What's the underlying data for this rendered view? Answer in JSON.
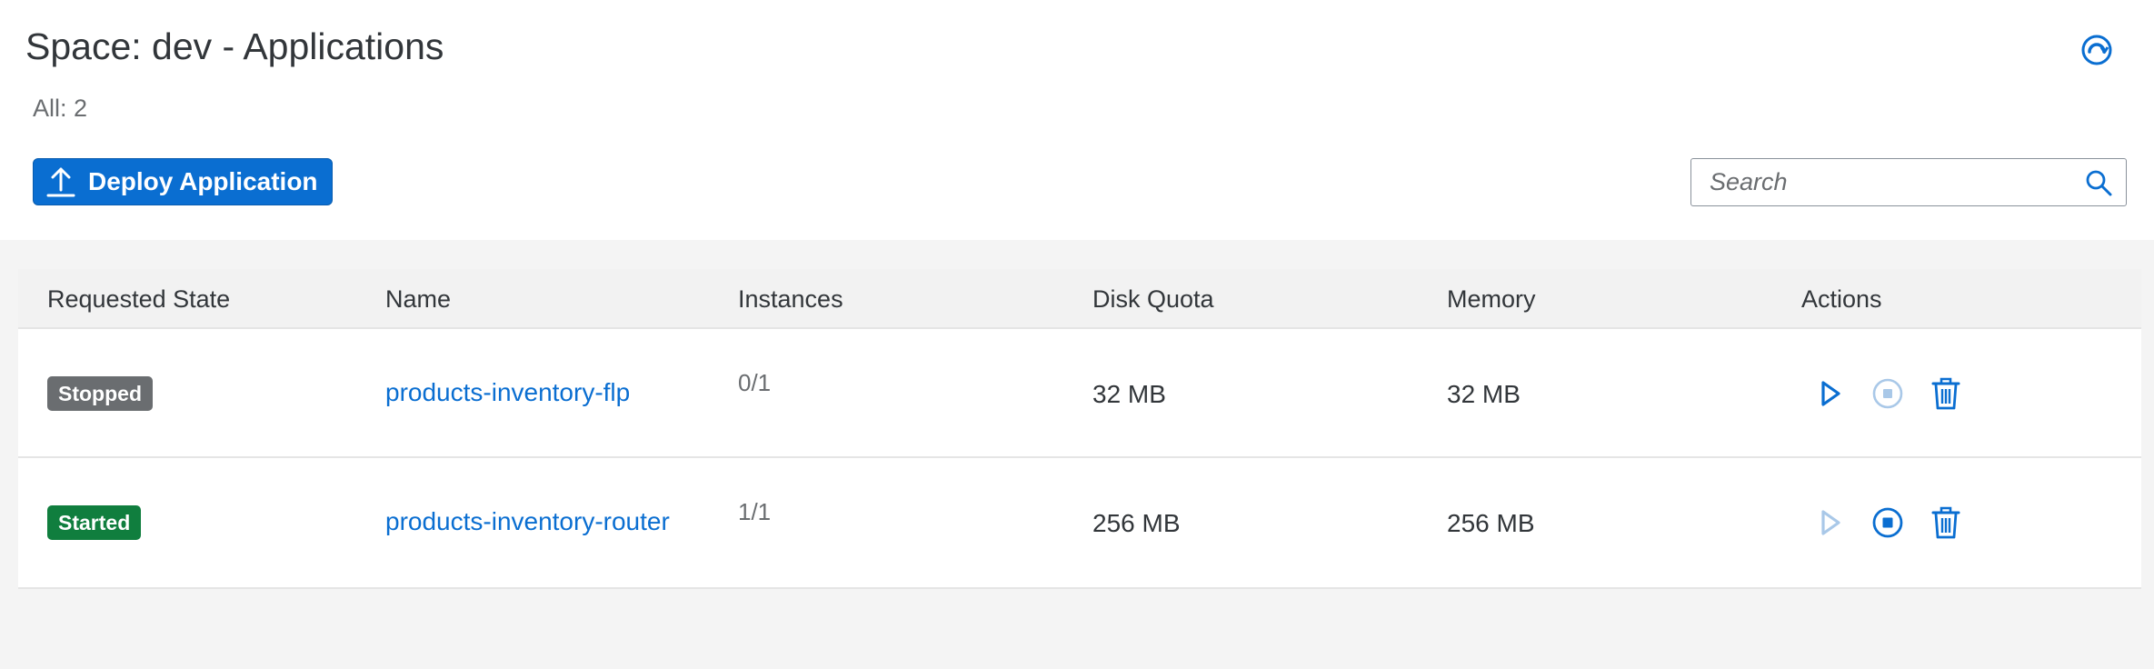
{
  "page": {
    "title": "Space: dev - Applications",
    "count_label": "All: 2"
  },
  "toolbar": {
    "deploy_label": "Deploy Application",
    "search_placeholder": "Search",
    "search_value": ""
  },
  "icons": {
    "refresh": "refresh-icon",
    "upload": "upload-icon",
    "search": "search-icon",
    "start": "play-icon",
    "stop": "stop-icon",
    "delete": "trash-icon"
  },
  "colors": {
    "accent": "#0a6ed1",
    "stopped_badge": "#6a6d70",
    "started_badge": "#107e3e",
    "disabled_action": "#a9c8e8"
  },
  "table": {
    "columns": [
      "Requested State",
      "Name",
      "Instances",
      "Disk Quota",
      "Memory",
      "Actions"
    ],
    "rows": [
      {
        "state": "Stopped",
        "name": "products-inventory-flp",
        "instances": "0/1",
        "disk_quota": "32 MB",
        "memory": "32 MB",
        "start_enabled": true,
        "stop_enabled": false,
        "delete_enabled": true
      },
      {
        "state": "Started",
        "name": "products-inventory-router",
        "instances": "1/1",
        "disk_quota": "256 MB",
        "memory": "256 MB",
        "start_enabled": false,
        "stop_enabled": true,
        "delete_enabled": true
      }
    ]
  }
}
